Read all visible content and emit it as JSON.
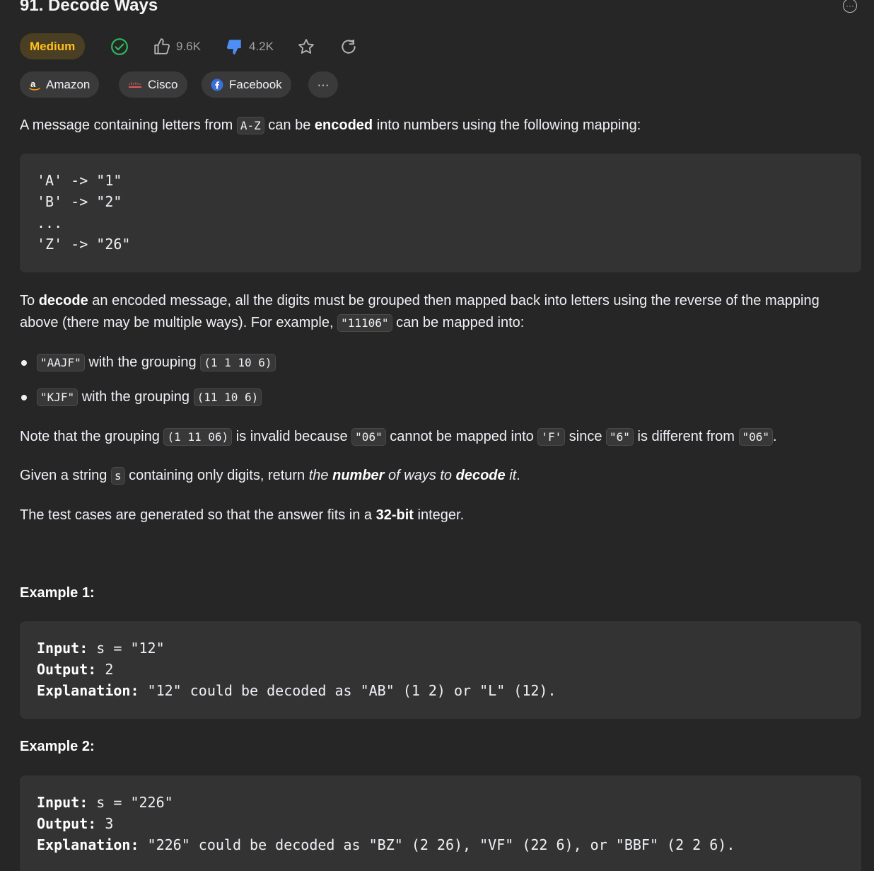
{
  "problem": {
    "title": "91. Decode Ways",
    "difficulty": "Medium",
    "likes": "9.6K",
    "dislikes": "4.2K"
  },
  "tags": [
    "Amazon",
    "Cisco",
    "Facebook",
    "···"
  ],
  "description": {
    "p1_pre": "A message containing letters from ",
    "p1_code": "A-Z",
    "p1_mid": " can be ",
    "p1_bold": "encoded",
    "p1_post": " into numbers using the following mapping:",
    "mapping_lines": [
      "'A' -> \"1\"",
      "'B' -> \"2\"",
      "...",
      "'Z' -> \"26\""
    ],
    "p2_pre": "To ",
    "p2_bold": "decode",
    "p2_post": " an encoded message, all the digits must be grouped then mapped back into letters using the reverse of the mapping above (there may be multiple ways). For example, ",
    "p2_code": "\"11106\"",
    "p2_end": " can be mapped into:",
    "bullet1_code1": "\"AAJF\"",
    "bullet1_text": " with the grouping ",
    "bullet1_code2": "(1 1 10 6)",
    "bullet2_code1": "\"KJF\"",
    "bullet2_text": " with the grouping ",
    "bullet2_code2": "(11 10 6)",
    "note_pre": "Note that the grouping ",
    "note_code1": "(1 11 06)",
    "note_mid1": " is invalid because ",
    "note_code2": "\"06\"",
    "note_mid2": " cannot be mapped into ",
    "note_code3": "'F'",
    "note_mid3": " since ",
    "note_code4": "\"6\"",
    "note_mid4": " is different from ",
    "note_code5": "\"06\"",
    "note_end": ".",
    "given_pre": "Given a string ",
    "given_code": "s",
    "given_mid": " containing only digits, return ",
    "given_i1": "the ",
    "given_b1": "number",
    "given_i2": " of ways to ",
    "given_b2": "decode",
    "given_i3": " it",
    "given_end": ".",
    "test_pre": "The test cases are generated so that the answer fits in a ",
    "test_bold": "32-bit",
    "test_post": " integer."
  },
  "examples": [
    {
      "title": "Example 1:",
      "input_label": "Input:",
      "input": " s = \"12\"",
      "output_label": "Output:",
      "output": " 2",
      "explanation_label": "Explanation:",
      "explanation": " \"12\" could be decoded as \"AB\" (1 2) or \"L\" (12)."
    },
    {
      "title": "Example 2:",
      "input_label": "Input:",
      "input": " s = \"226\"",
      "output_label": "Output:",
      "output": " 3",
      "explanation_label": "Explanation:",
      "explanation": " \"226\" could be decoded as \"BZ\" (2 26), \"VF\" (22 6), or \"BBF\" (2 2 6)."
    }
  ],
  "colors": {
    "background": "#262626",
    "difficulty_medium": "#ffc01e",
    "solved_check": "#2cbb5d",
    "dislike_active": "#4e8ef7"
  }
}
